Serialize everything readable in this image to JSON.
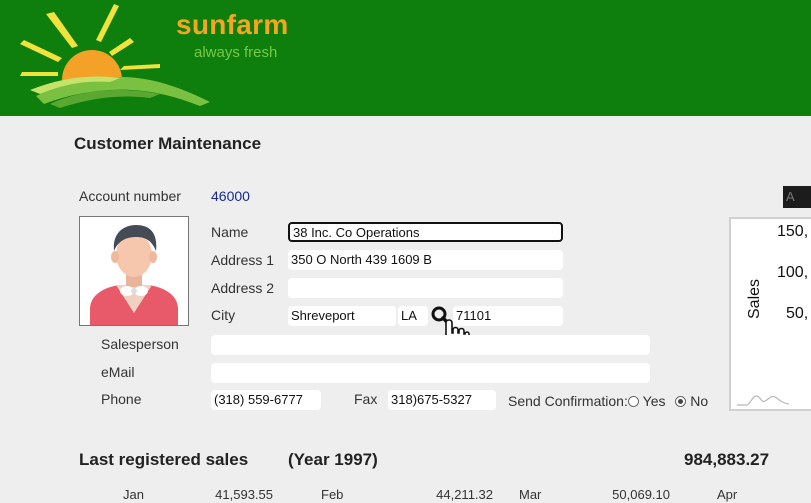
{
  "brand": {
    "name": "sunfarm",
    "tagline": "always fresh",
    "colors": {
      "header_bg": "#0e7e0c",
      "name": "#f6a521",
      "tagline": "#78c84a"
    }
  },
  "page_title": "Customer Maintenance",
  "account": {
    "label": "Account number",
    "value": "46000"
  },
  "form": {
    "name": {
      "label": "Name",
      "value": "38 Inc. Co Operations"
    },
    "address1": {
      "label": "Address 1",
      "value": "350 O North 439 1609 B"
    },
    "address2": {
      "label": "Address 2",
      "value": ""
    },
    "city": {
      "label": "City",
      "value": "Shreveport",
      "state": "LA",
      "zip": "71101"
    },
    "salesperson": {
      "label": "Salesperson",
      "value": ""
    },
    "email": {
      "label": "eMail",
      "value": ""
    },
    "phone": {
      "label": "Phone",
      "value": "(318) 559-6777"
    },
    "fax": {
      "label": "Fax",
      "value": "318)675-5327"
    },
    "send_confirmation": {
      "label": "Send Confirmation:",
      "options": [
        "Yes",
        "No"
      ],
      "selected": "No"
    }
  },
  "icons": {
    "city_lookup": "search-icon",
    "cursor": "hand-pointer-icon",
    "avatar": "customer-avatar-icon"
  },
  "mini_chart": {
    "ylabel": "Sales",
    "ticks": [
      "150,",
      "100,",
      "50,"
    ],
    "corner_tag": "A"
  },
  "sales": {
    "title": "Last registered sales",
    "year": "(Year 1997)",
    "total": "984,883.27",
    "months": [
      {
        "month": "Jan",
        "amount": "41,593.55"
      },
      {
        "month": "Feb",
        "amount": "44,211.32"
      },
      {
        "month": "Mar",
        "amount": "50,069.10"
      },
      {
        "month": "Apr",
        "amount": ""
      }
    ]
  }
}
